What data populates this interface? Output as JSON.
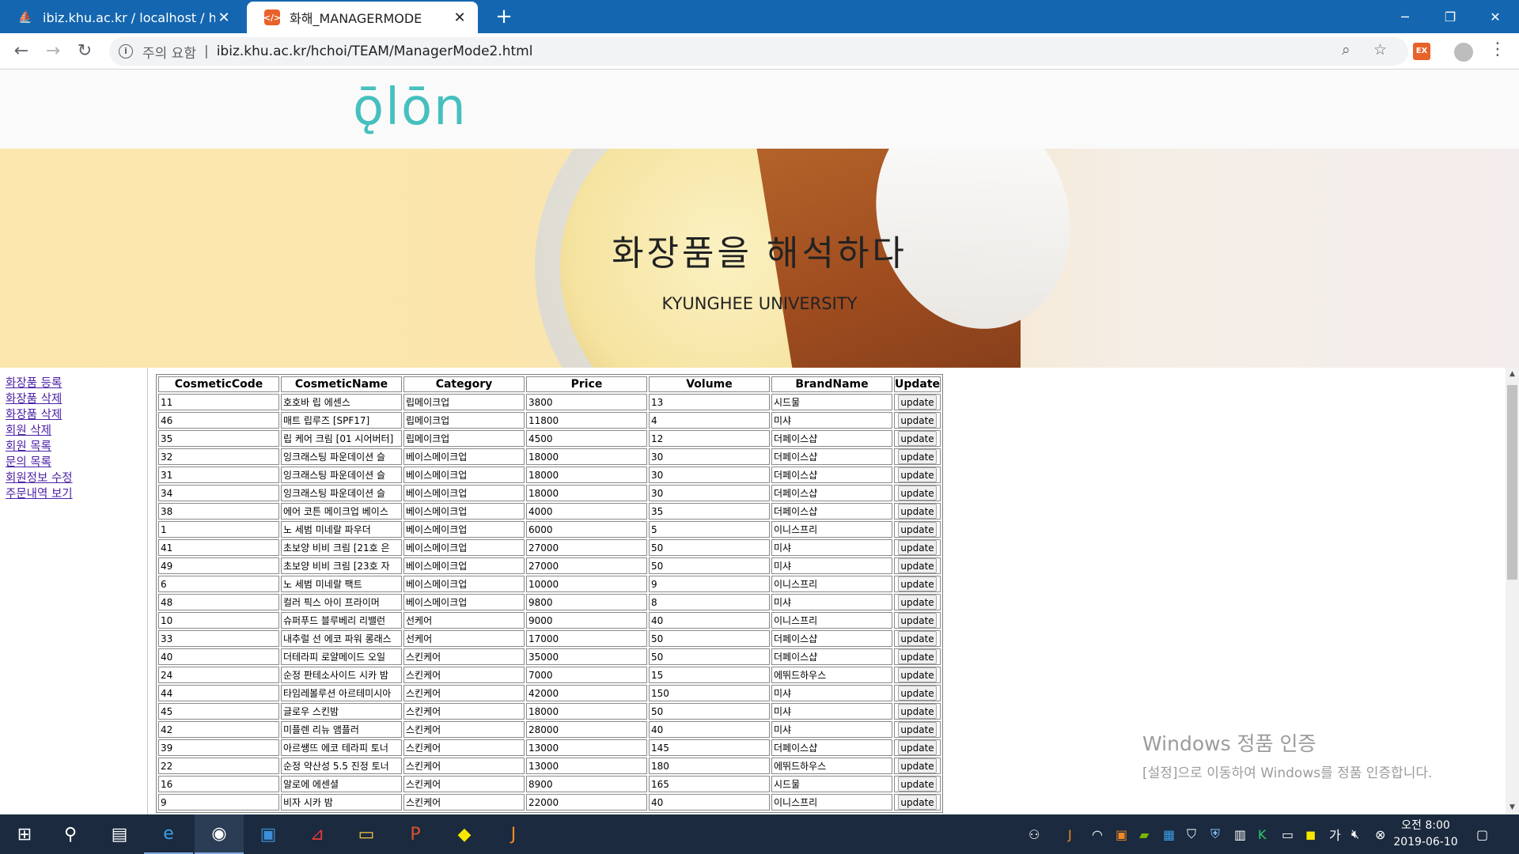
{
  "browser": {
    "tabs": [
      {
        "title": "ibiz.khu.ac.kr / localhost / hchoi",
        "active": false,
        "favicon": "phpmyadmin-sail-icon"
      },
      {
        "title": "화해_MANAGERMODE",
        "active": true,
        "favicon": "html-icon",
        "favicon_glyph": "&lt;/&gt;"
      }
    ],
    "new_tab": "+",
    "security_label": "주의 요함",
    "url": "ibiz.khu.ac.kr/hchoi/TEAM/ManagerMode2.html",
    "info_glyph": "i",
    "extension_label": "EX"
  },
  "page": {
    "logo_text": "ǭlōn",
    "banner_title": "화장품을 해석하다",
    "banner_subtitle": "KYUNGHEE UNIVERSITY",
    "sidebar_links": [
      "화장품 등록",
      "화장품 삭제",
      "화장품 삭제",
      "회원 삭제",
      "회원 목록",
      "문의 목록",
      "회원정보 수정",
      "주문내역 보기"
    ],
    "table": {
      "headers": [
        "CosmeticCode",
        "CosmeticName",
        "Category",
        "Price",
        "Volume",
        "BrandName",
        "Update"
      ],
      "button_label": "update",
      "rows": [
        [
          "11",
          "호호바 립 에센스",
          "립메이크업",
          "3800",
          "13",
          "시드물"
        ],
        [
          "46",
          "매트 립루즈 [SPF17]",
          "립메이크업",
          "11800",
          "4",
          "미샤"
        ],
        [
          "35",
          "립 케어 크림 [01 시어버터]",
          "립메이크업",
          "4500",
          "12",
          "더페이스샵"
        ],
        [
          "32",
          "잉크래스팅 파운데이션 슬",
          "베이스메이크업",
          "18000",
          "30",
          "더페이스샵"
        ],
        [
          "31",
          "잉크래스팅 파운데이션 슬",
          "베이스메이크업",
          "18000",
          "30",
          "더페이스샵"
        ],
        [
          "34",
          "잉크래스팅 파운데이션 슬",
          "베이스메이크업",
          "18000",
          "30",
          "더페이스샵"
        ],
        [
          "38",
          "에어 코튼 메이크업 베이스",
          "베이스메이크업",
          "4000",
          "35",
          "더페이스샵"
        ],
        [
          "1",
          "노 세범 미네랄 파우더",
          "베이스메이크업",
          "6000",
          "5",
          "이니스프리"
        ],
        [
          "41",
          "초보양 비비 크림 [21호 은",
          "베이스메이크업",
          "27000",
          "50",
          "미샤"
        ],
        [
          "49",
          "초보양 비비 크림 [23호 자",
          "베이스메이크업",
          "27000",
          "50",
          "미샤"
        ],
        [
          "6",
          "노 세범 미네랄 팩트",
          "베이스메이크업",
          "10000",
          "9",
          "이니스프리"
        ],
        [
          "48",
          "컬러 픽스 아이 프라이머",
          "베이스메이크업",
          "9800",
          "8",
          "미샤"
        ],
        [
          "10",
          "슈퍼푸드 블루베리 리밸런",
          "선케어",
          "9000",
          "40",
          "이니스프리"
        ],
        [
          "33",
          "내추럴 선 에코 파워 롱래스",
          "선케어",
          "17000",
          "50",
          "더페이스샵"
        ],
        [
          "40",
          "더테라피 로얄메이드 오일",
          "스킨케어",
          "35000",
          "50",
          "더페이스샵"
        ],
        [
          "24",
          "순정 판테소사이드 시카 밤",
          "스킨케어",
          "7000",
          "15",
          "에뛰드하우스"
        ],
        [
          "44",
          "타임레볼루션 아르테미시아",
          "스킨케어",
          "42000",
          "150",
          "미샤"
        ],
        [
          "45",
          "글로우 스킨밤",
          "스킨케어",
          "18000",
          "50",
          "미샤"
        ],
        [
          "42",
          "미플렌 리뉴 앰플러",
          "스킨케어",
          "28000",
          "40",
          "미샤"
        ],
        [
          "39",
          "아르쌩뜨 에코 테라피 토너",
          "스킨케어",
          "13000",
          "145",
          "더페이스샵"
        ],
        [
          "22",
          "순정 약산성 5.5 진정 토너",
          "스킨케어",
          "13000",
          "180",
          "에뛰드하우스"
        ],
        [
          "16",
          "알로에 에센셜",
          "스킨케어",
          "8900",
          "165",
          "시드물"
        ],
        [
          "9",
          "비자 시카 밤",
          "스킨케어",
          "22000",
          "40",
          "이니스프리"
        ]
      ]
    },
    "watermark_line1": "Windows 정품 인증",
    "watermark_line2": "[설정]으로 이동하여 Windows를 정품 인증합니다."
  },
  "taskbar": {
    "apps": [
      "start-icon",
      "search-icon",
      "notepad-icon",
      "internet-explorer-icon",
      "chrome-icon",
      "word-pad-icon",
      "acrobat-icon",
      "file-explorer-icon",
      "powerpoint-icon",
      "kakaotalk-icon",
      "java-icon"
    ],
    "ime_label": "가",
    "time": "오전 8:00",
    "date": "2019-06-10"
  }
}
